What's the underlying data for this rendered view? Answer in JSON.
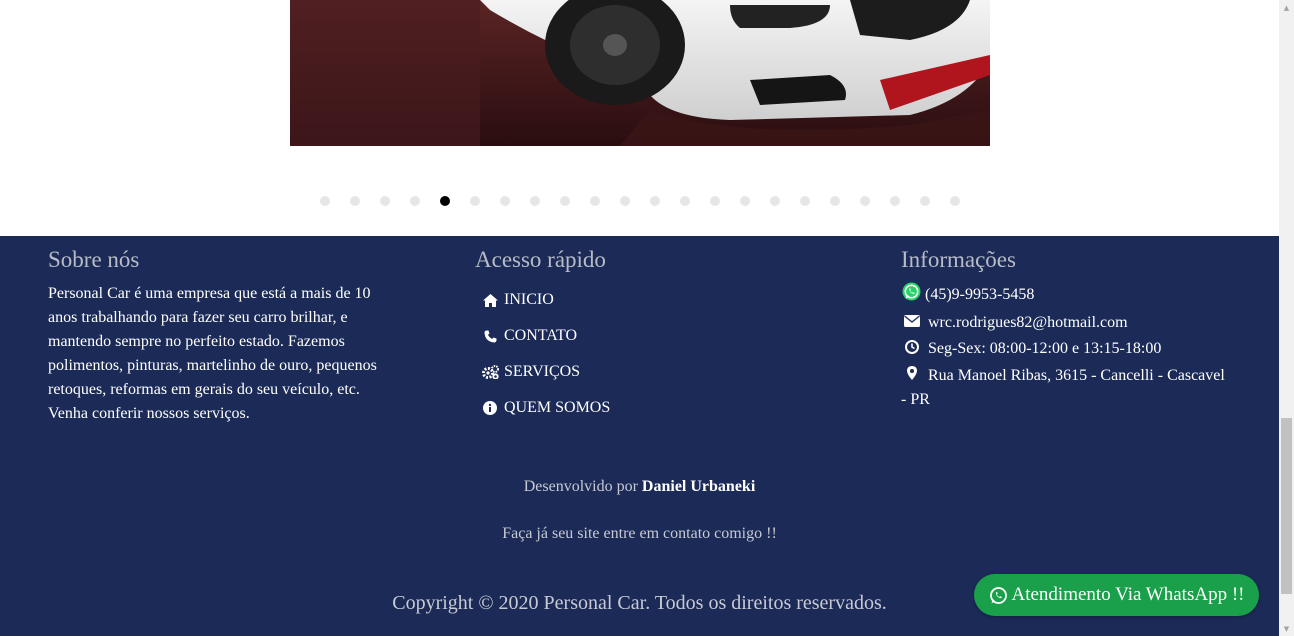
{
  "carousel": {
    "slide_count": 22,
    "active_index": 4
  },
  "footer": {
    "about": {
      "title": "Sobre nós",
      "text": "Personal Car é uma empresa que está a mais de 10 anos trabalhando para fazer seu carro brilhar, e mantendo sempre no perfeito estado. Fazemos polimentos, pinturas, martelinho de ouro, pequenos retoques, reformas em gerais do seu veículo, etc. Venha conferir nossos serviços."
    },
    "quick": {
      "title": "Acesso rápido",
      "items": [
        {
          "label": "INICIO",
          "icon": "home-icon"
        },
        {
          "label": "CONTATO",
          "icon": "phone-icon"
        },
        {
          "label": "SERVIÇOS",
          "icon": "gears-icon"
        },
        {
          "label": "QUEM SOMOS",
          "icon": "info-icon"
        }
      ]
    },
    "info": {
      "title": "Informações",
      "phone": "(45)9-9953-5458",
      "email": "wrc.rodrigues82@hotmail.com",
      "hours": "Seg-Sex: 08:00-12:00 e 13:15-18:00",
      "address": "Rua Manoel Ribas, 3615 - Cancelli - Cascavel - PR"
    },
    "dev_prefix": "Desenvolvido por",
    "dev_name": "Daniel Urbaneki",
    "cta": "Faça já seu site entre em contato comigo !!",
    "copyright": "Copyright © 2020 Personal Car. Todos os direitos reservados."
  },
  "whatsapp_button": {
    "label": "Atendimento Via WhatsApp !!",
    "color": "#1aa04a"
  },
  "colors": {
    "footer_bg": "#1b2a57",
    "heading": "#b9bcc6"
  }
}
